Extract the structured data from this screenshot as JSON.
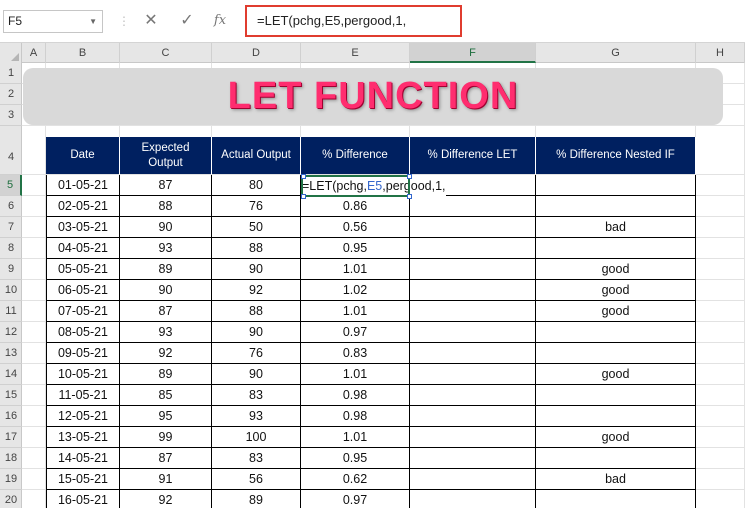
{
  "formula_bar": {
    "name_box": "F5",
    "cancel_icon": "✕",
    "enter_icon": "✓",
    "fx_label": "fx",
    "formula": "=LET(pchg,E5,pergood,1,"
  },
  "columns": [
    "A",
    "B",
    "C",
    "D",
    "E",
    "F",
    "G",
    "H"
  ],
  "rows": [
    "1",
    "2",
    "3",
    "4",
    "5",
    "6",
    "7",
    "8",
    "9",
    "10",
    "11",
    "12",
    "13",
    "14",
    "15",
    "16",
    "17",
    "18",
    "19",
    "20"
  ],
  "banner": {
    "title": "LET FUNCTION"
  },
  "table": {
    "headers": [
      "Date",
      "Expected Output",
      "Actual Output",
      "% Difference",
      "% Difference LET",
      "% Difference Nested IF"
    ],
    "rows": [
      [
        "01-05-21",
        "87",
        "80",
        "",
        "",
        ""
      ],
      [
        "02-05-21",
        "88",
        "76",
        "0.86",
        "",
        ""
      ],
      [
        "03-05-21",
        "90",
        "50",
        "0.56",
        "",
        "bad"
      ],
      [
        "04-05-21",
        "93",
        "88",
        "0.95",
        "",
        ""
      ],
      [
        "05-05-21",
        "89",
        "90",
        "1.01",
        "",
        "good"
      ],
      [
        "06-05-21",
        "90",
        "92",
        "1.02",
        "",
        "good"
      ],
      [
        "07-05-21",
        "87",
        "88",
        "1.01",
        "",
        "good"
      ],
      [
        "08-05-21",
        "93",
        "90",
        "0.97",
        "",
        ""
      ],
      [
        "09-05-21",
        "92",
        "76",
        "0.83",
        "",
        ""
      ],
      [
        "10-05-21",
        "89",
        "90",
        "1.01",
        "",
        "good"
      ],
      [
        "11-05-21",
        "85",
        "83",
        "0.98",
        "",
        ""
      ],
      [
        "12-05-21",
        "95",
        "93",
        "0.98",
        "",
        ""
      ],
      [
        "13-05-21",
        "99",
        "100",
        "1.01",
        "",
        "good"
      ],
      [
        "14-05-21",
        "87",
        "83",
        "0.95",
        "",
        ""
      ],
      [
        "15-05-21",
        "91",
        "56",
        "0.62",
        "",
        "bad"
      ],
      [
        "16-05-21",
        "92",
        "89",
        "0.97",
        "",
        ""
      ]
    ]
  },
  "editing": {
    "prefix": "=LET(pchg,",
    "ref": "E5",
    "suffix": ",pergood,1,"
  },
  "colors": {
    "header_fill": "#002060",
    "title_color": "#ff2d6f",
    "selection_green": "#217346",
    "formula_highlight": "#e03c2f"
  }
}
